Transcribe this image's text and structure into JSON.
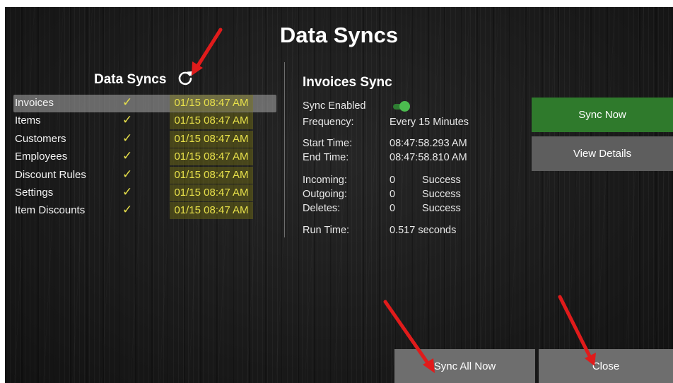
{
  "screen": {
    "title": "Data Syncs"
  },
  "sync_list": {
    "title": "Data Syncs",
    "refresh_icon": "refresh-icon",
    "status_color": "#e8e14a",
    "items": [
      {
        "name": "Invoices",
        "check": "✓",
        "time": "01/15 08:47 AM",
        "selected": true
      },
      {
        "name": "Items",
        "check": "✓",
        "time": "01/15 08:47 AM"
      },
      {
        "name": "Customers",
        "check": "✓",
        "time": "01/15 08:47 AM"
      },
      {
        "name": "Employees",
        "check": "✓",
        "time": "01/15 08:47 AM"
      },
      {
        "name": "Discount Rules",
        "check": "✓",
        "time": "01/15 08:47 AM"
      },
      {
        "name": "Settings",
        "check": "✓",
        "time": "01/15 08:47 AM"
      },
      {
        "name": "Item Discounts",
        "check": "✓",
        "time": "01/15 08:47 AM"
      }
    ]
  },
  "details": {
    "title": "Invoices Sync",
    "sync_enabled_label": "Sync Enabled",
    "sync_enabled": true,
    "frequency_label": "Frequency:",
    "frequency_value": "Every 15 Minutes",
    "start_label": "Start Time:",
    "start_value": "08:47:58.293 AM",
    "end_label": "End Time:",
    "end_value": "08:47:58.810 AM",
    "incoming_label": "Incoming:",
    "incoming_count": "0",
    "incoming_status": "Success",
    "outgoing_label": "Outgoing:",
    "outgoing_count": "0",
    "outgoing_status": "Success",
    "deletes_label": "Deletes:",
    "deletes_count": "0",
    "deletes_status": "Success",
    "runtime_label": "Run Time:",
    "runtime_value": "0.517 seconds"
  },
  "buttons": {
    "sync_now": "Sync Now",
    "view_details": "View Details",
    "sync_all_now": "Sync All Now",
    "close": "Close",
    "accent_green": "#2f7a2c"
  },
  "annotations": {
    "arrow_color": "#e01b1b"
  }
}
